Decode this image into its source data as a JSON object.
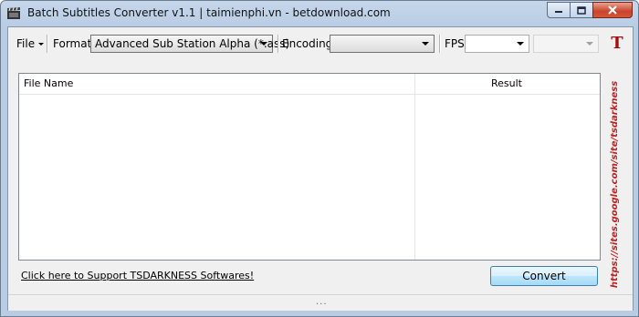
{
  "window": {
    "title": "Batch Subtitles Converter v1.1 | taimienphi.vn - betdownload.com",
    "icon": "film-clapper-icon",
    "controls": [
      "minimize-icon",
      "maximize-icon",
      "close-icon"
    ]
  },
  "toolbar": {
    "file_menu": "File",
    "format_label": "Format",
    "format_value": "Advanced Sub Station Alpha (*.ass)",
    "encoding_label": "Encoding",
    "encoding_value": "",
    "fps_label": "FPS",
    "fps_value": "",
    "fps2_value": "",
    "logo_text": "T"
  },
  "grid": {
    "columns": [
      "File Name",
      "Result"
    ],
    "rows": []
  },
  "footer": {
    "support_link": "Click here to Support TSDARKNESS Softwares!",
    "convert_button": "Convert",
    "side_url": "https://sites.google.com/site/tsdarkness"
  },
  "statusbar": {
    "grip": "..."
  },
  "colors": {
    "accent": "#c81e1e",
    "title_bg": "#b8cce4",
    "button_border": "#3c7fb1"
  }
}
